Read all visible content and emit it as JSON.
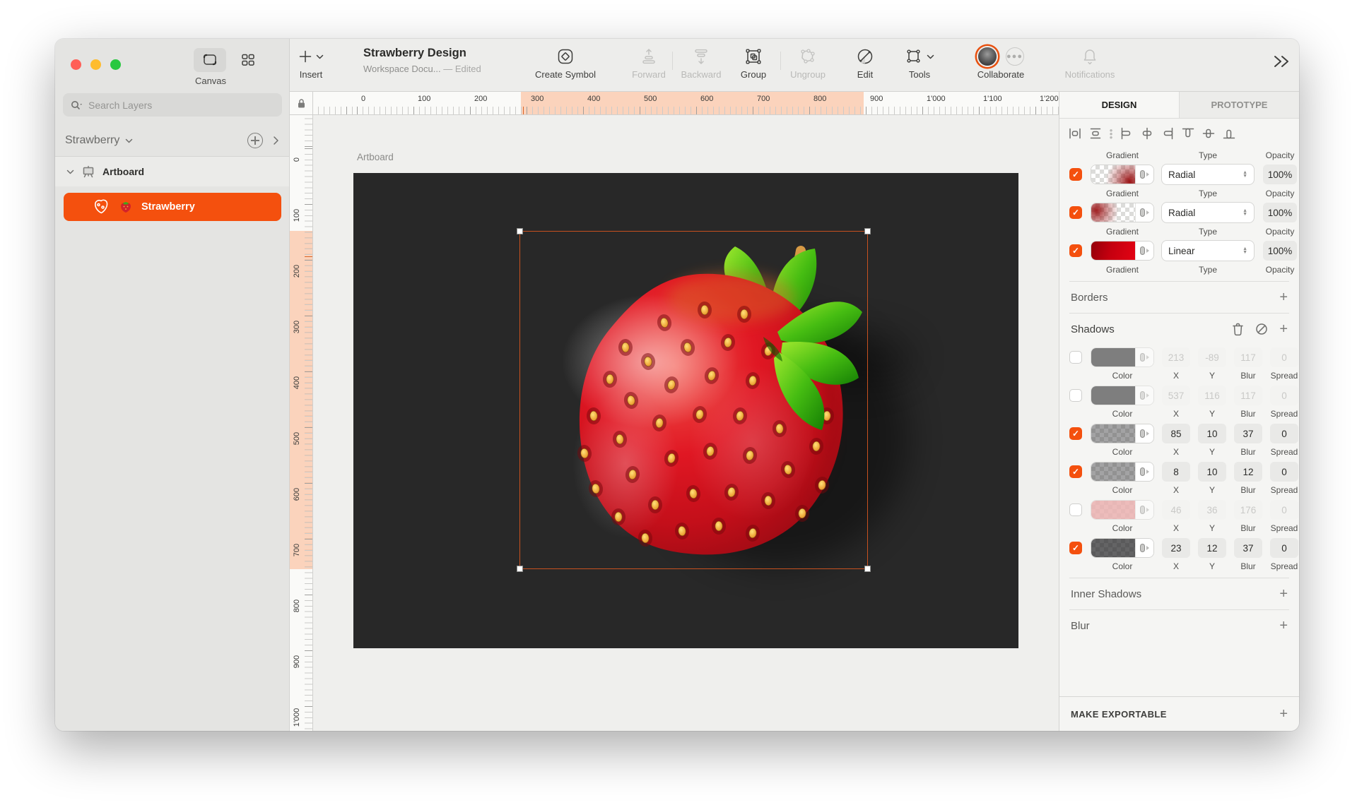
{
  "window": {
    "title": "Strawberry Design",
    "doc_status": "Workspace Docu...",
    "edited": "— Edited"
  },
  "chrome": {
    "canvas_label": "Canvas"
  },
  "toolbar": {
    "insert": "Insert",
    "create_symbol": "Create Symbol",
    "forward": "Forward",
    "backward": "Backward",
    "group": "Group",
    "ungroup": "Ungroup",
    "edit": "Edit",
    "tools": "Tools",
    "collaborate": "Collaborate",
    "notifications": "Notifications"
  },
  "sidebar": {
    "search_placeholder": "Search Layers",
    "page": "Strawberry",
    "layers": [
      {
        "label": "Artboard"
      },
      {
        "label": "Strawberry",
        "selected": true
      }
    ]
  },
  "canvas": {
    "artboard_label": "Artboard"
  },
  "rulers": {
    "horizontal": [
      "0",
      "100",
      "200",
      "300",
      "400",
      "500",
      "600",
      "700",
      "800",
      "900",
      "1'000",
      "1'100",
      "1'200"
    ],
    "vertical": [
      "0",
      "100",
      "200",
      "300",
      "400",
      "500",
      "600",
      "700",
      "800",
      "900",
      "1'000"
    ]
  },
  "panel": {
    "tabs": {
      "design": "DESIGN",
      "prototype": "PROTOTYPE"
    },
    "fills": {
      "col_labels": {
        "gradient": "Gradient",
        "type": "Type",
        "opacity": "Opacity"
      },
      "rows": [
        {
          "checked": true,
          "swatch": "grad-br",
          "type": "Radial",
          "opacity": "100%"
        },
        {
          "checked": true,
          "swatch": "grad-tl",
          "type": "Radial",
          "opacity": "100%"
        },
        {
          "checked": true,
          "swatch": "grad-red",
          "type": "Linear",
          "opacity": "100%"
        }
      ]
    },
    "borders": {
      "title": "Borders"
    },
    "shadows": {
      "title": "Shadows",
      "col_labels": {
        "color": "Color",
        "x": "X",
        "y": "Y",
        "blur": "Blur",
        "spread": "Spread"
      },
      "rows": [
        {
          "checked": false,
          "swatch": "black",
          "x": "213",
          "y": "-89",
          "blur": "117",
          "spread": "0"
        },
        {
          "checked": false,
          "swatch": "black",
          "x": "537",
          "y": "116",
          "blur": "117",
          "spread": "0"
        },
        {
          "checked": true,
          "swatch": "checker-gray",
          "x": "85",
          "y": "10",
          "blur": "37",
          "spread": "0"
        },
        {
          "checked": true,
          "swatch": "checker-gray",
          "x": "8",
          "y": "10",
          "blur": "12",
          "spread": "0"
        },
        {
          "checked": false,
          "swatch": "checker-pink",
          "x": "46",
          "y": "36",
          "blur": "176",
          "spread": "0"
        },
        {
          "checked": true,
          "swatch": "checker-dark",
          "x": "23",
          "y": "12",
          "blur": "37",
          "spread": "0"
        }
      ]
    },
    "inner_shadows": {
      "title": "Inner Shadows"
    },
    "blur": {
      "title": "Blur"
    },
    "make_exportable": {
      "title": "MAKE EXPORTABLE"
    }
  },
  "colors": {
    "accent": "#F4500E",
    "selection_border": "#C8511F",
    "artboard_bg": "#282828",
    "ruler_highlight": "#FBD3BC"
  }
}
